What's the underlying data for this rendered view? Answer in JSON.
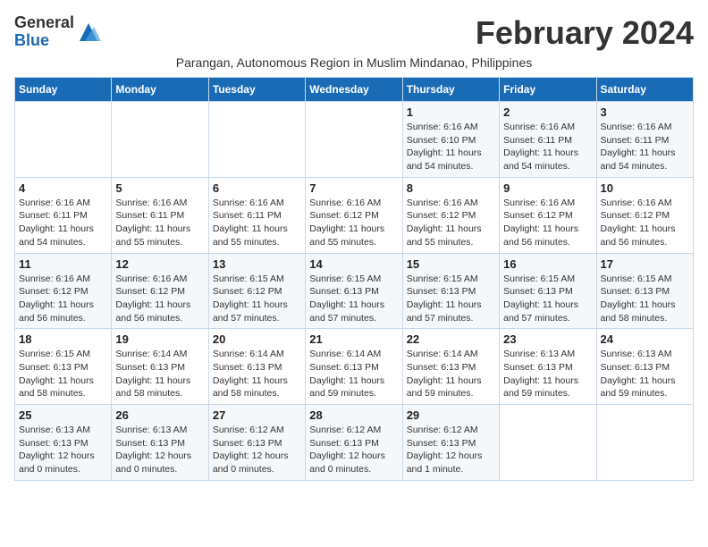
{
  "header": {
    "logo_general": "General",
    "logo_blue": "Blue",
    "month_title": "February 2024",
    "subtitle": "Parangan, Autonomous Region in Muslim Mindanao, Philippines"
  },
  "calendar": {
    "days_of_week": [
      "Sunday",
      "Monday",
      "Tuesday",
      "Wednesday",
      "Thursday",
      "Friday",
      "Saturday"
    ],
    "weeks": [
      [
        {
          "day": "",
          "detail": ""
        },
        {
          "day": "",
          "detail": ""
        },
        {
          "day": "",
          "detail": ""
        },
        {
          "day": "",
          "detail": ""
        },
        {
          "day": "1",
          "detail": "Sunrise: 6:16 AM\nSunset: 6:10 PM\nDaylight: 11 hours and 54 minutes."
        },
        {
          "day": "2",
          "detail": "Sunrise: 6:16 AM\nSunset: 6:11 PM\nDaylight: 11 hours and 54 minutes."
        },
        {
          "day": "3",
          "detail": "Sunrise: 6:16 AM\nSunset: 6:11 PM\nDaylight: 11 hours and 54 minutes."
        }
      ],
      [
        {
          "day": "4",
          "detail": "Sunrise: 6:16 AM\nSunset: 6:11 PM\nDaylight: 11 hours and 54 minutes."
        },
        {
          "day": "5",
          "detail": "Sunrise: 6:16 AM\nSunset: 6:11 PM\nDaylight: 11 hours and 55 minutes."
        },
        {
          "day": "6",
          "detail": "Sunrise: 6:16 AM\nSunset: 6:11 PM\nDaylight: 11 hours and 55 minutes."
        },
        {
          "day": "7",
          "detail": "Sunrise: 6:16 AM\nSunset: 6:12 PM\nDaylight: 11 hours and 55 minutes."
        },
        {
          "day": "8",
          "detail": "Sunrise: 6:16 AM\nSunset: 6:12 PM\nDaylight: 11 hours and 55 minutes."
        },
        {
          "day": "9",
          "detail": "Sunrise: 6:16 AM\nSunset: 6:12 PM\nDaylight: 11 hours and 56 minutes."
        },
        {
          "day": "10",
          "detail": "Sunrise: 6:16 AM\nSunset: 6:12 PM\nDaylight: 11 hours and 56 minutes."
        }
      ],
      [
        {
          "day": "11",
          "detail": "Sunrise: 6:16 AM\nSunset: 6:12 PM\nDaylight: 11 hours and 56 minutes."
        },
        {
          "day": "12",
          "detail": "Sunrise: 6:16 AM\nSunset: 6:12 PM\nDaylight: 11 hours and 56 minutes."
        },
        {
          "day": "13",
          "detail": "Sunrise: 6:15 AM\nSunset: 6:12 PM\nDaylight: 11 hours and 57 minutes."
        },
        {
          "day": "14",
          "detail": "Sunrise: 6:15 AM\nSunset: 6:13 PM\nDaylight: 11 hours and 57 minutes."
        },
        {
          "day": "15",
          "detail": "Sunrise: 6:15 AM\nSunset: 6:13 PM\nDaylight: 11 hours and 57 minutes."
        },
        {
          "day": "16",
          "detail": "Sunrise: 6:15 AM\nSunset: 6:13 PM\nDaylight: 11 hours and 57 minutes."
        },
        {
          "day": "17",
          "detail": "Sunrise: 6:15 AM\nSunset: 6:13 PM\nDaylight: 11 hours and 58 minutes."
        }
      ],
      [
        {
          "day": "18",
          "detail": "Sunrise: 6:15 AM\nSunset: 6:13 PM\nDaylight: 11 hours and 58 minutes."
        },
        {
          "day": "19",
          "detail": "Sunrise: 6:14 AM\nSunset: 6:13 PM\nDaylight: 11 hours and 58 minutes."
        },
        {
          "day": "20",
          "detail": "Sunrise: 6:14 AM\nSunset: 6:13 PM\nDaylight: 11 hours and 58 minutes."
        },
        {
          "day": "21",
          "detail": "Sunrise: 6:14 AM\nSunset: 6:13 PM\nDaylight: 11 hours and 59 minutes."
        },
        {
          "day": "22",
          "detail": "Sunrise: 6:14 AM\nSunset: 6:13 PM\nDaylight: 11 hours and 59 minutes."
        },
        {
          "day": "23",
          "detail": "Sunrise: 6:13 AM\nSunset: 6:13 PM\nDaylight: 11 hours and 59 minutes."
        },
        {
          "day": "24",
          "detail": "Sunrise: 6:13 AM\nSunset: 6:13 PM\nDaylight: 11 hours and 59 minutes."
        }
      ],
      [
        {
          "day": "25",
          "detail": "Sunrise: 6:13 AM\nSunset: 6:13 PM\nDaylight: 12 hours and 0 minutes."
        },
        {
          "day": "26",
          "detail": "Sunrise: 6:13 AM\nSunset: 6:13 PM\nDaylight: 12 hours and 0 minutes."
        },
        {
          "day": "27",
          "detail": "Sunrise: 6:12 AM\nSunset: 6:13 PM\nDaylight: 12 hours and 0 minutes."
        },
        {
          "day": "28",
          "detail": "Sunrise: 6:12 AM\nSunset: 6:13 PM\nDaylight: 12 hours and 0 minutes."
        },
        {
          "day": "29",
          "detail": "Sunrise: 6:12 AM\nSunset: 6:13 PM\nDaylight: 12 hours and 1 minute."
        },
        {
          "day": "",
          "detail": ""
        },
        {
          "day": "",
          "detail": ""
        }
      ]
    ]
  }
}
